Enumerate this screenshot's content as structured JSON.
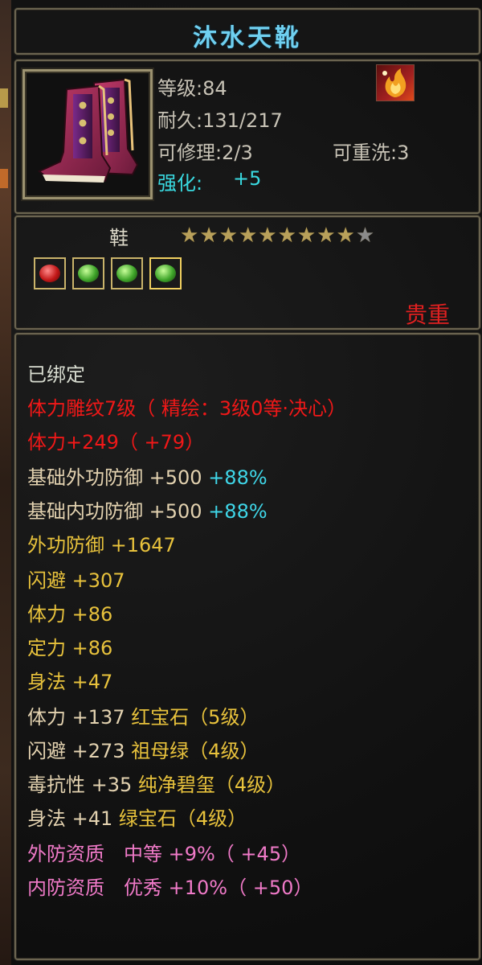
{
  "item": {
    "name": "沐水天靴",
    "level": "等级:84",
    "durability": "耐久:131/217",
    "repair": "可修理:2/3",
    "rewash": "可重洗:3",
    "strengthen_label": "强化:",
    "strengthen_value": "+5",
    "type": "鞋",
    "stars_filled": 9,
    "stars_total": 10,
    "quality": "贵重",
    "gems": [
      {
        "kind": "red",
        "icon": "red-gem-icon"
      },
      {
        "kind": "green",
        "icon": "green-gem-icon"
      },
      {
        "kind": "green",
        "icon": "green-gem-icon"
      },
      {
        "kind": "green-selected",
        "icon": "green-gem-icon"
      }
    ]
  },
  "attributes": {
    "bound": "已绑定",
    "engrave": "体力雕纹7级（ 精绘：3级0等·决心）",
    "vitality_bonus": "体力+249（ +79）",
    "base_ext_def_label": "基础外功防御 +500",
    "base_ext_def_pct": "+88%",
    "base_int_def_label": "基础内功防御 +500",
    "base_int_def_pct": "+88%",
    "ext_def": "外功防御 +1647",
    "dodge": "闪避 +307",
    "vitality": "体力 +86",
    "focus": "定力 +86",
    "agility": "身法 +47",
    "gem_vitality": "体力 +137 红宝石（5级）",
    "gem_dodge": "闪避 +273 祖母绿（4级）",
    "gem_poison": "毒抗性 +35 纯净碧玺（4级）",
    "gem_agility": "身法 +41 绿宝石（4级）",
    "ext_quality": "外防资质　中等 +9%（ +45）",
    "int_quality": "内防资质　优秀 +10%（ +50）"
  },
  "colors": {
    "title": "#6fd0f0",
    "red": "#f01818",
    "cyan": "#3fd6e8",
    "yellow": "#e8c23c",
    "pink": "#f07ac8"
  }
}
